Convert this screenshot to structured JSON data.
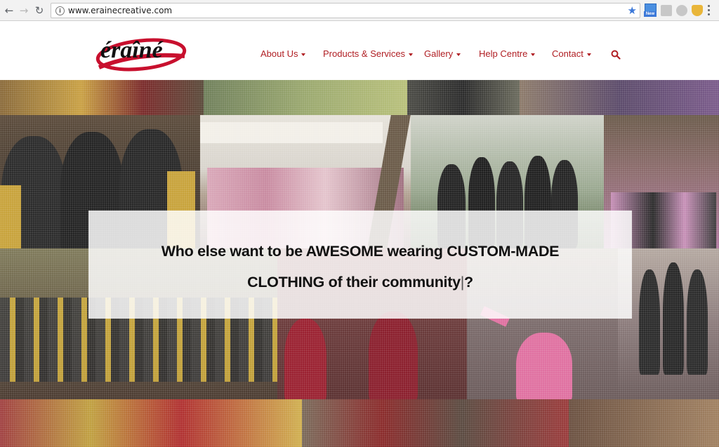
{
  "browser": {
    "url": "www.erainecreative.com",
    "ext_new_label": "New"
  },
  "site": {
    "logo_text": "éraîné",
    "nav": [
      {
        "label": "About Us"
      },
      {
        "label": "Products & Services"
      },
      {
        "label": "Gallery"
      },
      {
        "label": "Help Centre"
      },
      {
        "label": "Contact"
      }
    ]
  },
  "hero": {
    "headline_line1": "Who else want to be AWESOME wearing CUSTOM-MADE",
    "headline_line2": "CLOTHING of their community",
    "typing_cursor": "|",
    "headline_end": "?"
  },
  "colors": {
    "brand_red": "#b01e23",
    "chrome_bg": "#f2f2f2",
    "star_blue": "#3c78d8"
  }
}
